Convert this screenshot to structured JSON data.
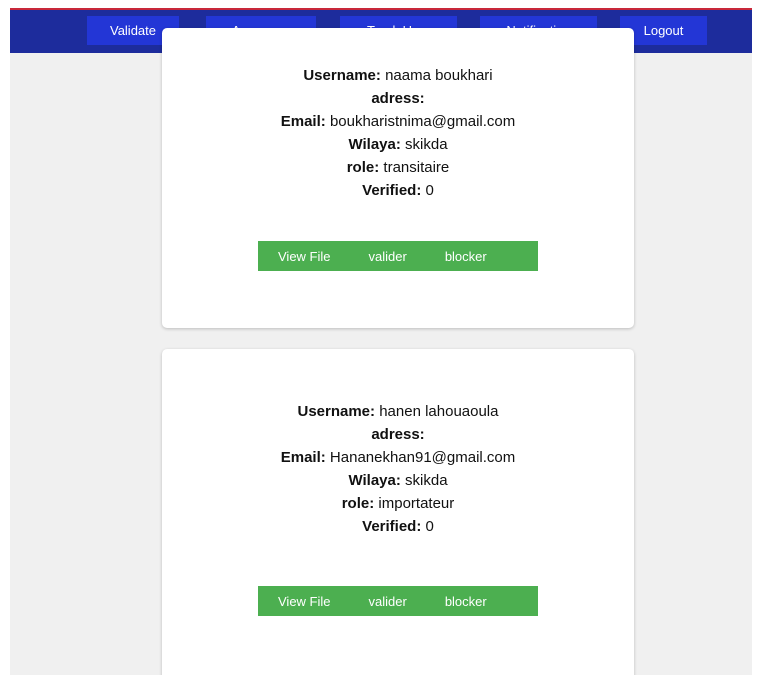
{
  "nav": {
    "items": [
      "Validate",
      "Announce",
      "Track User",
      "Notification",
      "Logout"
    ]
  },
  "users": [
    {
      "username_label": "Username:",
      "username": "naama boukhari",
      "adress_label": "adress:",
      "adress": "",
      "email_label": "Email:",
      "email": "boukharistnima@gmail.com",
      "wilaya_label": "Wilaya:",
      "wilaya": "skikda",
      "role_label": "role:",
      "role": "transitaire",
      "verified_label": "Verified:",
      "verified": "0",
      "actions": [
        "View File",
        "valider",
        "blocker"
      ]
    },
    {
      "username_label": "Username:",
      "username": "hanen lahouaoula",
      "adress_label": "adress:",
      "adress": "",
      "email_label": "Email:",
      "email": "Hananekhan91@gmail.com",
      "wilaya_label": "Wilaya:",
      "wilaya": "skikda",
      "role_label": "role:",
      "role": "importateur",
      "verified_label": "Verified:",
      "verified": "0",
      "actions": [
        "View File",
        "valider",
        "blocker"
      ]
    }
  ],
  "colors": {
    "navbar": "#1d2c9c",
    "nav_button": "#2336d6",
    "top_accent": "#c8283a",
    "action_bar": "#4caf50",
    "page_background": "#f0f0f0"
  }
}
